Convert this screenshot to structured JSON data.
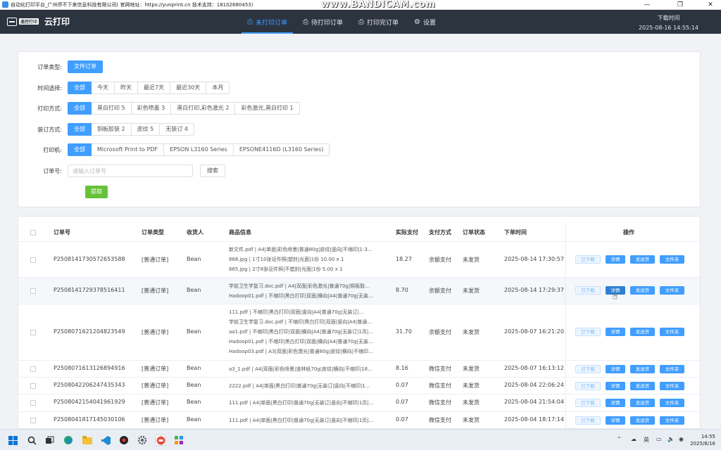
{
  "window": {
    "title": "自动化打印平台_广州停不下来信息科技有限公司( 官网地址：https://yunprint.cn 技术支持：18102680453)",
    "watermark": "www.BANDICAM.com",
    "controls": {
      "minimize": "—",
      "restore": "❐",
      "close": "✕"
    }
  },
  "app": {
    "brand_badge": "遥控打印",
    "name": "云打印",
    "tabs": [
      {
        "label": "未打印订单",
        "icon": "printer-icon",
        "glyph": "⎙",
        "active": true
      },
      {
        "label": "待打印订单",
        "icon": "printer-icon",
        "glyph": "⎙",
        "active": false
      },
      {
        "label": "打印完订单",
        "icon": "printer-icon",
        "glyph": "⎙",
        "active": false
      },
      {
        "label": "设置",
        "icon": "gear-icon",
        "glyph": "⚙",
        "active": false
      }
    ],
    "download_time_label": "下载时间",
    "download_time_value": "2025-08-16 14:55:14"
  },
  "filters": {
    "order_type": {
      "label": "订单类型:",
      "options": [
        "文件订单"
      ]
    },
    "time": {
      "label": "时间选择:",
      "options": [
        "全部",
        "今天",
        "昨天",
        "最近7天",
        "最近30天",
        "本月"
      ]
    },
    "print_mode": {
      "label": "打印方式:",
      "options": [
        "全部",
        "黑白打印 5",
        "彩色喷墨 3",
        "黑白打印,彩色激光 2",
        "彩色激光,黑白打印 1"
      ]
    },
    "binding": {
      "label": "装订方式:",
      "options": [
        "全部",
        "铜板胶装 2",
        "皮纹 5",
        "无装订 4"
      ]
    },
    "printer": {
      "label": "打印机:",
      "options": [
        "全部",
        "Microsoft Print to PDF",
        "EPSON L3160 Series",
        "EPSONE4116D (L3160 Series)"
      ]
    },
    "order_no": {
      "label": "订单号:",
      "placeholder": "请输入订单号",
      "value": "",
      "search_label": "搜索"
    },
    "extract_label": "提取"
  },
  "table": {
    "headers": {
      "order_no": "订单号",
      "order_type": "订单类型",
      "recipient": "收货人",
      "product": "商品信息",
      "paid": "实际支付",
      "pay_method": "支付方式",
      "status": "订单状态",
      "order_time": "下单时间",
      "actions": "操作"
    },
    "action_labels": {
      "downloaded": "已下载",
      "detail": "详情",
      "ship": "发送货",
      "folder": "文件夹"
    },
    "rows": [
      {
        "order_no": "P2508141730572653588",
        "order_type": "[普通订单]",
        "recipient": "Bean",
        "product": [
          "新文件.pdf | A4|单面|彩色喷墨|普通80g|皮纹|竖向|不缩印|1-3…",
          "868.jpg | 1寸10张证件照|塑封|光面|1份   10.00 x 1",
          "865.jpg | 2寸8张证件照|不塑封|光面|1份   5.00 x 1"
        ],
        "paid": "18.27",
        "pay_method": "余额支付",
        "status": "未发货",
        "order_time": "2025-08-14 17:30:57"
      },
      {
        "order_no": "P2508141729378516411",
        "order_type": "[普通订单]",
        "recipient": "Bean",
        "product": [
          "学前卫生学复习.doc.pdf | A4|双面|彩色激光|普通70g|铜板胶…",
          "Hadoop01.pdf | 不缩印|黑白打印|双面|横向|A4|普通70g|无装…"
        ],
        "paid": "8.70",
        "pay_method": "余额支付",
        "status": "未发货",
        "order_time": "2025-08-14 17:29:37"
      },
      {
        "order_no": "P2508071621204823549",
        "order_type": "[普通订单]",
        "recipient": "Bean",
        "product": [
          "111.pdf | 不缩印|黑白打印|双面|竖向|A4|普通70g|无装订|…",
          "学前卫生学复习.doc.pdf | 不缩印|黑白打印|双面|竖向|A4|普通…",
          "aa1.pdf | 不缩印|黑白打印|双面|横向|A4|普通70g|无装订|1页|…",
          "Hadoop01.pdf | 不缩印|黑白打印|双面|横向|A4|普通70g|无装…",
          "Hadoop03.pdf | A3|双面|彩色激光|普通80g|皮纹|横向|不缩印…"
        ],
        "paid": "31.70",
        "pay_method": "余额支付",
        "status": "未发货",
        "order_time": "2025-08-07 16:21:20"
      },
      {
        "order_no": "P2508071613126894916",
        "order_type": "[普通订单]",
        "recipient": "Bean",
        "product": [
          "a3_1.pdf | A4|双面|彩色喷墨|道林纸70g|皮纹|横向|不缩印|18…"
        ],
        "paid": "8.16",
        "pay_method": "微信支付",
        "status": "未发货",
        "order_time": "2025-08-07 16:13:12"
      },
      {
        "order_no": "P2508042206247435343",
        "order_type": "[普通订单]",
        "recipient": "Bean",
        "product": [
          "2222.pdf | A4|单面|黑白打印|普通70g|无装订|竖向|不缩印|1…"
        ],
        "paid": "0.07",
        "pay_method": "微信支付",
        "status": "未发货",
        "order_time": "2025-08-04 22:06:24"
      },
      {
        "order_no": "P2508042154041961929",
        "order_type": "[普通订单]",
        "recipient": "Bean",
        "product": [
          "111.pdf | A4|单面|黑白打印|普通70g|无装订|竖向|不缩印|1页|…"
        ],
        "paid": "0.07",
        "pay_method": "微信支付",
        "status": "未发货",
        "order_time": "2025-08-04 21:54:04"
      },
      {
        "order_no": "P2508041817145030106",
        "order_type": "[普通订单]",
        "recipient": "Bean",
        "product": [
          "111.pdf | A4|单面|黑白打印|普通70g|无装订|竖向|不缩印|1页|…"
        ],
        "paid": "0.07",
        "pay_method": "微信支付",
        "status": "未发货",
        "order_time": "2025-08-04 18:17:14"
      }
    ]
  },
  "taskbar": {
    "icons": [
      "windows-start-icon",
      "search-icon",
      "task-view-icon",
      "edge-browser-icon",
      "file-explorer-icon",
      "vscode-icon",
      "bandicam-icon",
      "settings-icon",
      "yunprint-app-icon",
      "app-icon"
    ],
    "ime": "英",
    "time": "14:55",
    "date": "2025/8/16"
  },
  "colors": {
    "primary": "#409eff",
    "success": "#67c23a",
    "header_bg": "#2c3440"
  }
}
